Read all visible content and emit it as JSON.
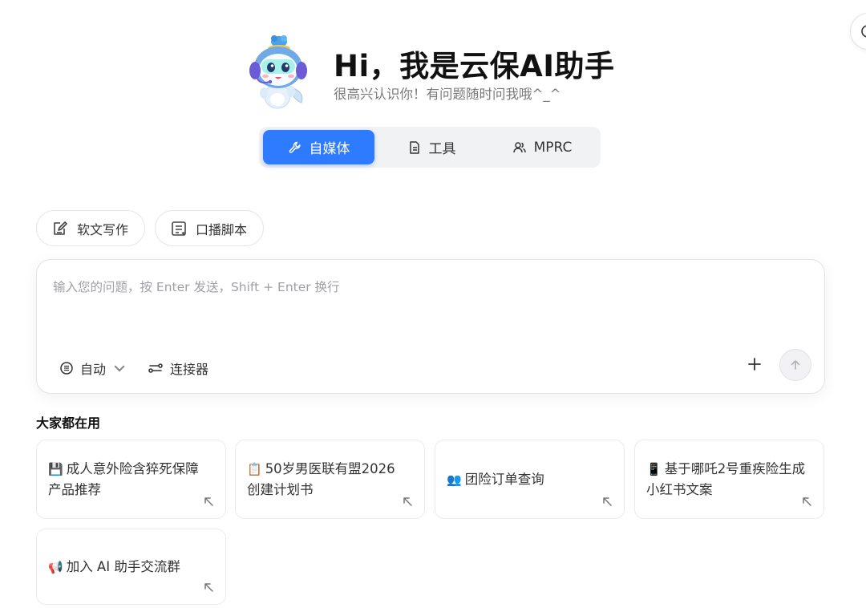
{
  "hero": {
    "title": "Hi，我是云保AI助手",
    "subtitle": "很高兴认识你！有问题随时问我哦^_^"
  },
  "mode_tabs": [
    {
      "label": "自媒体",
      "icon": "wrench-icon",
      "active": true
    },
    {
      "label": "工具",
      "icon": "document-icon",
      "active": false
    },
    {
      "label": "MPRC",
      "icon": "users-icon",
      "active": false
    }
  ],
  "chips": [
    {
      "label": "软文写作",
      "icon": "edit-doc-icon"
    },
    {
      "label": "口播脚本",
      "icon": "script-icon"
    }
  ],
  "input": {
    "placeholder": "输入您的问题，按 Enter 发送，Shift + Enter 换行",
    "mode_label": "自动",
    "connector_label": "连接器"
  },
  "popular": {
    "title": "大家都在用",
    "cards": [
      {
        "emoji": "💾",
        "text": "成人意外险含猝死保障产品推荐"
      },
      {
        "emoji": "📋",
        "text": "50岁男医联有盟2026创建计划书"
      },
      {
        "emoji": "👥",
        "text": "团险订单查询"
      },
      {
        "emoji": "📱",
        "text": "基于哪吒2号重疾险生成小红书文案"
      },
      {
        "emoji": "📢",
        "text": "加入 AI 助手交流群"
      }
    ]
  },
  "colors": {
    "accent": "#2f7bff",
    "tab_bar_bg": "#f1f2f4"
  }
}
